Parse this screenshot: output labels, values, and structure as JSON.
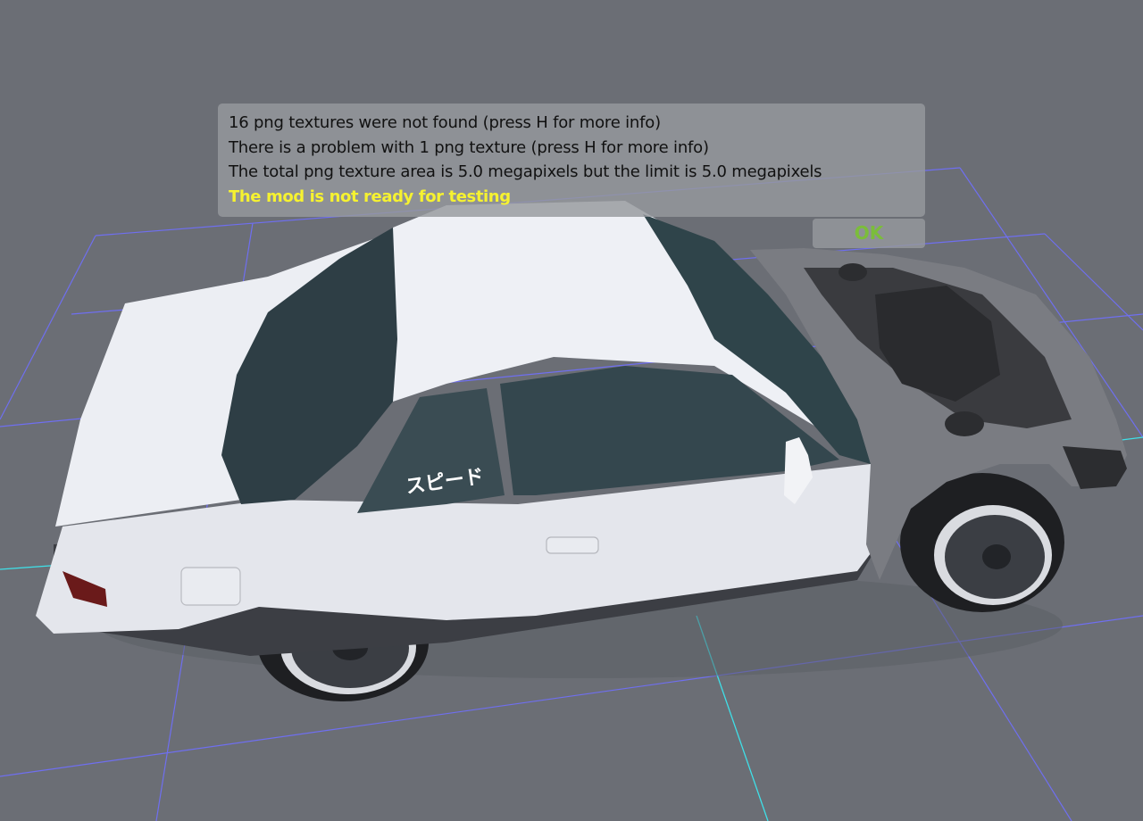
{
  "dialog": {
    "lines": [
      "16 png textures were not found (press H for more info)",
      "There is a problem with 1 png texture (press H for more info)",
      "The total png texture area is 5.0 megapixels but the limit is 5.0 megapixels"
    ],
    "status": "The mod is not ready for testing",
    "ok_label": "OK"
  },
  "car": {
    "decal_text": "スピード"
  },
  "colors": {
    "background": "#6b6e75",
    "grid_lines": "#6f6ff0",
    "axis_line": "#3fe0e8",
    "warning_text": "#f6f230",
    "ok_text": "#7bbd3a",
    "car_body": "#e6e8ee"
  }
}
